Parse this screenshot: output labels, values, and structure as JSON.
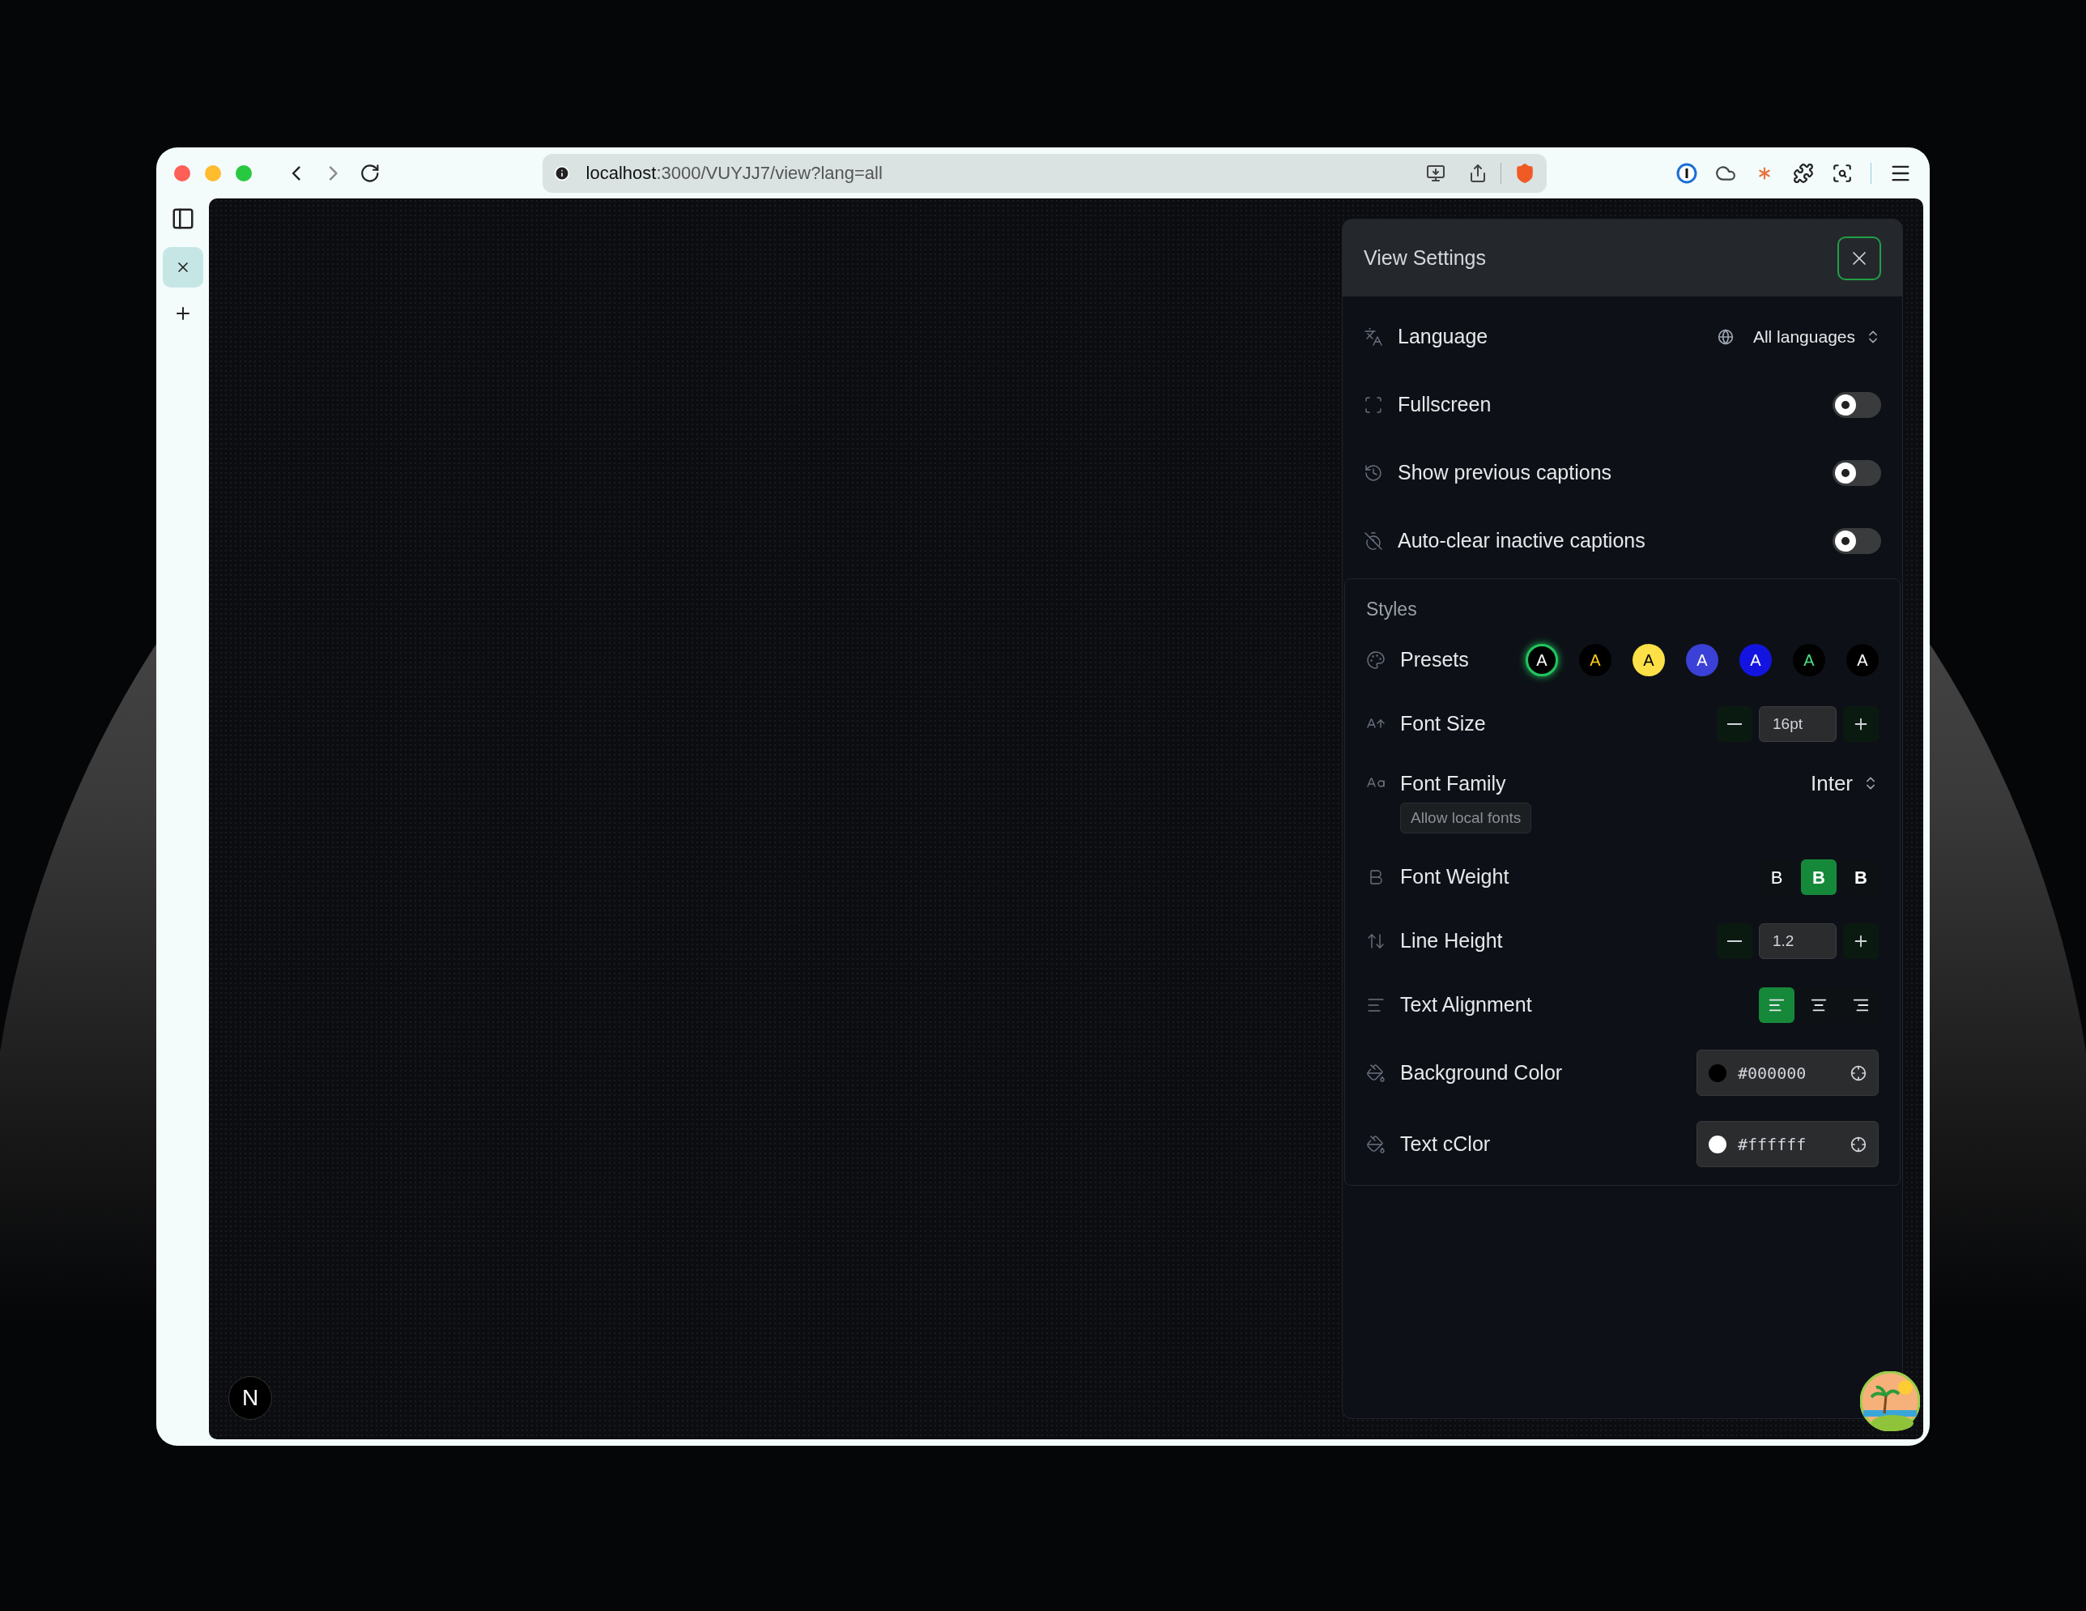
{
  "browser": {
    "url_host": "localhost",
    "url_rest": ":3000/VUYJJ7/view?lang=all"
  },
  "corner_badge": "N",
  "panel": {
    "title": "View Settings",
    "general": [
      {
        "kind": "select",
        "label": "Language",
        "value": "All languages"
      },
      {
        "kind": "toggle",
        "label": "Fullscreen",
        "on": false
      },
      {
        "kind": "toggle",
        "label": "Show previous captions",
        "on": false
      },
      {
        "kind": "toggle",
        "label": "Auto-clear inactive captions",
        "on": false
      }
    ],
    "styles": {
      "heading": "Styles",
      "rows": [
        {
          "kind": "presets",
          "label": "Presets",
          "items": [
            {
              "letter": "A",
              "color": "#000000",
              "kind": "light",
              "selected": true
            },
            {
              "letter": "A",
              "color": "#000000",
              "kind": "yellow",
              "selected": false
            },
            {
              "letter": "A",
              "color": "#fde047",
              "kind": "dark",
              "selected": false
            },
            {
              "letter": "A",
              "color": "#3b40d6",
              "kind": "light",
              "selected": false
            },
            {
              "letter": "A",
              "color": "#1414e0",
              "kind": "light",
              "selected": false
            },
            {
              "letter": "A",
              "color": "#000000",
              "kind": "green",
              "selected": false
            },
            {
              "letter": "A",
              "color": "#000000",
              "kind": "light",
              "selected": false
            }
          ]
        },
        {
          "kind": "stepper",
          "label": "Font Size",
          "value": "16pt"
        },
        {
          "kind": "select",
          "label": "Font Family",
          "value": "Inter",
          "extra_button": "Allow local fonts"
        },
        {
          "kind": "weights",
          "label": "Font Weight",
          "options": [
            {
              "label": "B",
              "kind": "regular",
              "selected": false
            },
            {
              "label": "B",
              "kind": "semibold",
              "selected": true
            },
            {
              "label": "B",
              "kind": "bold",
              "selected": false
            }
          ]
        },
        {
          "kind": "stepper",
          "label": "Line Height",
          "value": "1.2"
        },
        {
          "kind": "alignment",
          "label": "Text Alignment",
          "options": [
            {
              "kind": "left",
              "selected": true
            },
            {
              "kind": "center",
              "selected": false
            },
            {
              "kind": "right",
              "selected": false
            }
          ]
        },
        {
          "kind": "color",
          "label": "Background Color",
          "value": "#000000"
        },
        {
          "kind": "color",
          "label": "Text cClor",
          "value": "#ffffff"
        }
      ]
    }
  }
}
